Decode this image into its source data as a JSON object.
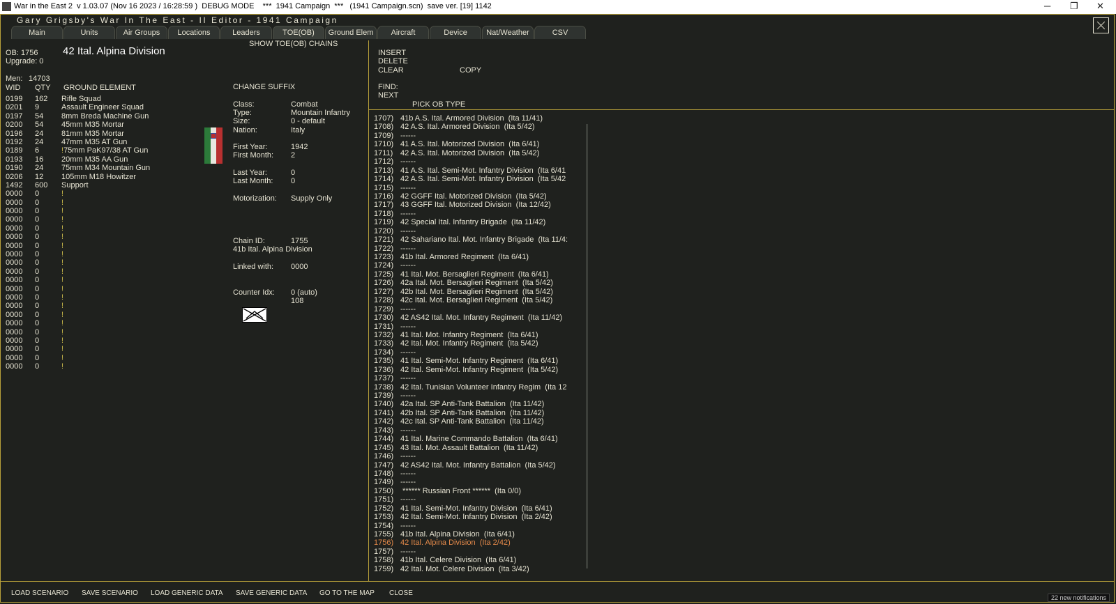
{
  "window": {
    "title": "War in the East 2  v 1.03.07 (Nov 16 2023 / 16:28:59 )  DEBUG MODE    ***  1941 Campaign  ***   (1941 Campaign.scn)  save ver. [19] 1142",
    "minimize": "─",
    "maximize": "❐",
    "close": "✕"
  },
  "editor_title": "Gary Grigsby's War In The East - II Editor - 1941 Campaign",
  "tabs": [
    "Main",
    "Units",
    "Air Groups",
    "Locations",
    "Leaders",
    "TOE(OB)",
    "Ground Elem",
    "Aircraft",
    "Device",
    "Nat/Weather",
    "CSV"
  ],
  "active_tab": "TOE(OB)",
  "show_chains": "SHOW TOE(OB) CHAINS",
  "ob": {
    "ob_label": "OB: 1756",
    "upgrade_label": "Upgrade: 0",
    "name": "42 Ital. Alpina Division",
    "men_label": "Men:",
    "men_value": "14703"
  },
  "elements": {
    "headers": {
      "wid": "WID",
      "qty": "QTY",
      "name": "GROUND ELEMENT"
    },
    "wid": [
      "0199",
      "0201",
      "0197",
      "0200",
      "0196",
      "0192",
      "0189",
      "0193",
      "0190",
      "0206",
      "1492",
      "0000",
      "0000",
      "0000",
      "0000",
      "0000",
      "0000",
      "0000",
      "0000",
      "0000",
      "0000",
      "0000",
      "0000",
      "0000",
      "0000",
      "0000",
      "0000",
      "0000",
      "0000",
      "0000",
      "0000",
      "0000"
    ],
    "qty": [
      "162",
      "9",
      "54",
      "54",
      "24",
      "24",
      "6",
      "16",
      "24",
      "12",
      "600",
      "0",
      "0",
      "0",
      "0",
      "0",
      "0",
      "0",
      "0",
      "0",
      "0",
      "0",
      "0",
      "0",
      "0",
      "0",
      "0",
      "0",
      "0",
      "0",
      "0",
      "0"
    ],
    "names": [
      "Rifle Squad",
      "Assault Engineer Squad",
      "8mm Breda Machine Gun",
      "45mm M35 Mortar",
      "81mm M35 Mortar",
      "47mm M35 AT Gun",
      "!75mm PaK97/38 AT Gun",
      "20mm M35 AA Gun",
      "75mm M34 Mountain Gun",
      "105mm M18 Howitzer",
      "Support",
      "!",
      "!",
      "!",
      "!",
      "!",
      "!",
      "!",
      "!",
      "!",
      "!",
      "!",
      "!",
      "!",
      "!",
      "!",
      "!",
      "!",
      "!",
      "!",
      "!",
      "!"
    ]
  },
  "details": {
    "change_suffix": "CHANGE SUFFIX",
    "class_label": "Class:",
    "class_value": "Combat",
    "type_label": "Type:",
    "type_value": "Mountain Infantry",
    "size_label": "Size:",
    "size_value": "0 - default",
    "nation_label": "Nation:",
    "nation_value": "Italy",
    "first_year_label": "First Year:",
    "first_year_value": "1942",
    "first_month_label": "First Month:",
    "first_month_value": "2",
    "last_year_label": "Last Year:",
    "last_year_value": "0",
    "last_month_label": "Last Month:",
    "last_month_value": "0",
    "motorization_label": "Motorization:",
    "motorization_value": "Supply Only",
    "chain_id_label": "Chain ID:",
    "chain_id_value": "1755",
    "chain_name": "41b Ital. Alpina Division",
    "linked_label": "Linked with:",
    "linked_value": "0000",
    "counter_label": "Counter Idx:",
    "counter_value": "0 (auto)",
    "counter_sub": "108"
  },
  "actions": {
    "insert": "INSERT",
    "delete": "DELETE",
    "clear": "CLEAR",
    "copy": "COPY",
    "find": "FIND:",
    "next": "NEXT",
    "pick_ob_type": "PICK OB TYPE"
  },
  "ob_list": [
    {
      "num": "1707)",
      "name": "41b A.S. Ital. Armored Division  (Ita 11/41)"
    },
    {
      "num": "1708)",
      "name": "42 A.S. Ital. Armored Division  (Ita 5/42)"
    },
    {
      "num": "1709)",
      "name": "------"
    },
    {
      "num": "1710)",
      "name": "41 A.S. Ital. Motorized Division  (Ita 6/41)"
    },
    {
      "num": "1711)",
      "name": "42 A.S. Ital. Motorized Division  (Ita 5/42)"
    },
    {
      "num": "1712)",
      "name": "------"
    },
    {
      "num": "1713)",
      "name": "41 A.S. Ital. Semi-Mot. Infantry Division  (Ita 6/41"
    },
    {
      "num": "1714)",
      "name": "42 A.S. Ital. Semi-Mot. Infantry Division  (Ita 5/42"
    },
    {
      "num": "1715)",
      "name": "------"
    },
    {
      "num": "1716)",
      "name": "42 GGFF Ital. Motorized Division  (Ita 5/42)"
    },
    {
      "num": "1717)",
      "name": "43 GGFF Ital. Motorized Division  (Ita 12/42)"
    },
    {
      "num": "1718)",
      "name": "------"
    },
    {
      "num": "1719)",
      "name": "42 Special Ital. Infantry Brigade  (Ita 11/42)"
    },
    {
      "num": "1720)",
      "name": "------"
    },
    {
      "num": "1721)",
      "name": "42 Sahariano Ital. Mot. Infantry Brigade  (Ita 11/4:"
    },
    {
      "num": "1722)",
      "name": "------"
    },
    {
      "num": "1723)",
      "name": "41b Ital. Armored Regiment  (Ita 6/41)"
    },
    {
      "num": "1724)",
      "name": "------"
    },
    {
      "num": "1725)",
      "name": "41 Ital. Mot. Bersaglieri Regiment  (Ita 6/41)"
    },
    {
      "num": "1726)",
      "name": "42a Ital. Mot. Bersaglieri Regiment  (Ita 5/42)"
    },
    {
      "num": "1727)",
      "name": "42b Ital. Mot. Bersaglieri Regiment  (Ita 5/42)"
    },
    {
      "num": "1728)",
      "name": "42c Ital. Mot. Bersaglieri Regiment  (Ita 5/42)"
    },
    {
      "num": "1729)",
      "name": "------"
    },
    {
      "num": "1730)",
      "name": "42 AS42 Ital. Mot. Infantry Regiment  (Ita 11/42)"
    },
    {
      "num": "1731)",
      "name": "------"
    },
    {
      "num": "1732)",
      "name": "41 Ital. Mot. Infantry Regiment  (Ita 6/41)"
    },
    {
      "num": "1733)",
      "name": "42 Ital. Mot. Infantry Regiment  (Ita 5/42)"
    },
    {
      "num": "1734)",
      "name": "------"
    },
    {
      "num": "1735)",
      "name": "41 Ital. Semi-Mot. Infantry Regiment  (Ita 6/41)"
    },
    {
      "num": "1736)",
      "name": "42 Ital. Semi-Mot. Infantry Regiment  (Ita 5/42)"
    },
    {
      "num": "1737)",
      "name": "------"
    },
    {
      "num": "1738)",
      "name": "42 Ital. Tunisian Volunteer Infantry Regim  (Ita 12"
    },
    {
      "num": "1739)",
      "name": "------"
    },
    {
      "num": "1740)",
      "name": "42a Ital. SP Anti-Tank Battalion  (Ita 11/42)"
    },
    {
      "num": "1741)",
      "name": "42b Ital. SP Anti-Tank Battalion  (Ita 11/42)"
    },
    {
      "num": "1742)",
      "name": "42c Ital. SP Anti-Tank Battalion  (Ita 11/42)"
    },
    {
      "num": "1743)",
      "name": "------"
    },
    {
      "num": "1744)",
      "name": "41 Ital. Marine Commando Battalion  (Ita 6/41)"
    },
    {
      "num": "1745)",
      "name": "43 Ital. Mot. Assault Battalion  (Ita 11/42)"
    },
    {
      "num": "1746)",
      "name": "------"
    },
    {
      "num": "1747)",
      "name": "42 AS42 Ital. Mot. Infantry Battalion  (Ita 5/42)"
    },
    {
      "num": "1748)",
      "name": "------"
    },
    {
      "num": "1749)",
      "name": "------"
    },
    {
      "num": "1750)",
      "name": " ****** Russian Front ******  (Ita 0/0)"
    },
    {
      "num": "1751)",
      "name": "------"
    },
    {
      "num": "1752)",
      "name": "41 Ital. Semi-Mot. Infantry Division  (Ita 6/41)"
    },
    {
      "num": "1753)",
      "name": "42 Ital. Semi-Mot. Infantry Division  (Ita 2/42)"
    },
    {
      "num": "1754)",
      "name": "------"
    },
    {
      "num": "1755)",
      "name": "41b Ital. Alpina Division  (Ita 6/41)"
    },
    {
      "num": "1756)",
      "name": "42 Ital. Alpina Division  (Ita 2/42)"
    },
    {
      "num": "1757)",
      "name": "------"
    },
    {
      "num": "1758)",
      "name": "41b Ital. Celere Division  (Ita 6/41)"
    },
    {
      "num": "1759)",
      "name": "42 Ital. Mot. Celere Division  (Ita 3/42)"
    }
  ],
  "selected_ob": "1756)",
  "bottom_buttons": [
    "LOAD SCENARIO",
    "SAVE SCENARIO",
    "LOAD GENERIC DATA",
    "SAVE GENERIC DATA",
    "GO TO THE MAP",
    "CLOSE"
  ],
  "notifications": "22 new notifications",
  "colors": {
    "background": "#1f211e",
    "accent_line": "#b8a13a",
    "text": "#e6e3d2",
    "selected": "#e58a4a"
  }
}
